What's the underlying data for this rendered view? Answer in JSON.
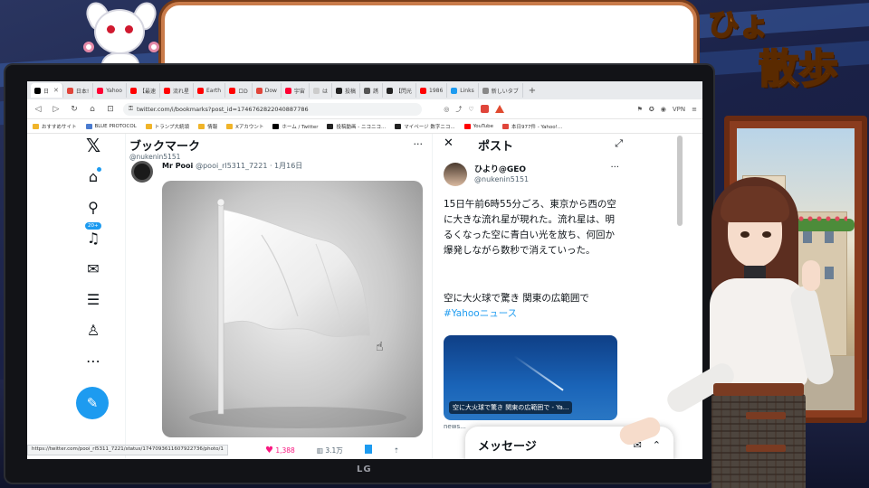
{
  "stream": {
    "title_line1": "ひょ",
    "title_line2": "散歩"
  },
  "browser": {
    "tabs": [
      {
        "label": "日",
        "color": "#000000"
      },
      {
        "label": "日本!",
        "color": "#e0453a"
      },
      {
        "label": "Yahoo",
        "color": "#ff0033"
      },
      {
        "label": "【最速",
        "color": "#ff0000"
      },
      {
        "label": "流れ星",
        "color": "#ff0000"
      },
      {
        "label": "Earth",
        "color": "#ff0000"
      },
      {
        "label": "ロD",
        "color": "#ff0000"
      },
      {
        "label": "Dow",
        "color": "#e0453a"
      },
      {
        "label": "宇宙",
        "color": "#ff0033"
      },
      {
        "label": "は",
        "color": "#cccccc"
      },
      {
        "label": "投稿",
        "color": "#222222"
      },
      {
        "label": "誘",
        "color": "#555555"
      },
      {
        "label": "【閃光",
        "color": "#222222"
      },
      {
        "label": "1986",
        "color": "#ff0000"
      },
      {
        "label": "Links",
        "color": "#1d9bf0"
      },
      {
        "label": "新しいタブ",
        "color": "#888888"
      }
    ],
    "url": "twitter.com/i/bookmarks?post_id=1746762822040887786",
    "vpn_label": "VPN",
    "bookmarks": [
      {
        "label": "おすすめサイト",
        "color": "#f0b429"
      },
      {
        "label": "BLUE PROTOCOL",
        "color": "#4a7bd0"
      },
      {
        "label": "トランプ大統領",
        "color": "#f0b429"
      },
      {
        "label": "情報",
        "color": "#f0b429"
      },
      {
        "label": "Xアカウント",
        "color": "#f0b429"
      },
      {
        "label": "ホーム / Twitter",
        "color": "#000000"
      },
      {
        "label": "投稿動画 - ニコニコ...",
        "color": "#222222"
      },
      {
        "label": "マイページ 数字ニコ...",
        "color": "#222222"
      },
      {
        "label": "YouTube",
        "color": "#ff0000"
      },
      {
        "label": "本日977件 - Yahoo!...",
        "color": "#e0453a"
      }
    ],
    "status_url": "https://twitter.com/pooi_rl5311_7221/status/1747093611607922736/photo/1"
  },
  "twitter": {
    "notif_count": "20+",
    "timeline_title": "ブックマーク",
    "timeline_handle": "@nukenin5151",
    "tweet_author": "Mr Pooi",
    "tweet_meta": "@pooi_rl5311_7221 · 1月16日",
    "likes": "1,388",
    "views": "3.1万",
    "post_panel": {
      "title": "ポスト",
      "name": "ひより@GEO",
      "handle": "@nukenin5151",
      "text": "15日午前6時55分ごろ、東京から西の空に大きな流れ星が現れた。流れ星は、明るくなった空に青白い光を放ち、何回か爆発しながら数秒で消えていった。",
      "text2": "空に大火球で驚き 関東の広範囲で",
      "hashtag": "#Yahooニュース",
      "card_caption": "空に大火球で驚き 関東の広範囲で - Ya...",
      "card_source": "news..."
    },
    "messages_title": "メッセージ"
  },
  "monitor_brand": "LG"
}
